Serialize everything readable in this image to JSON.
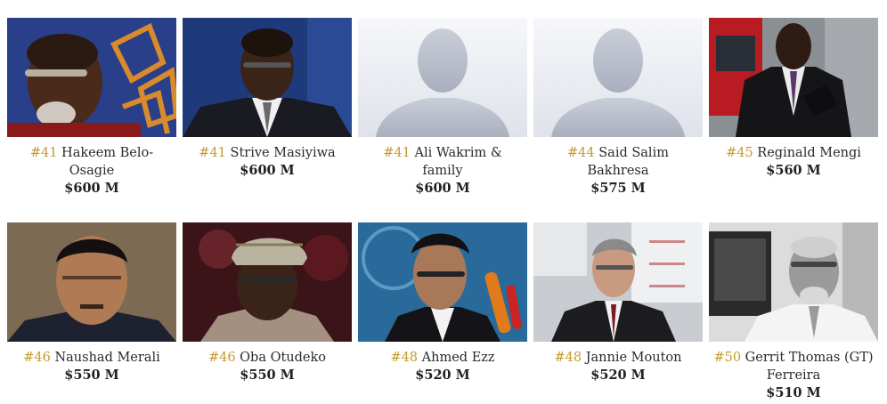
{
  "people": [
    {
      "rank": "#41",
      "name": "Hakeem Belo-Osagie",
      "worth": "$600 M",
      "photo": "portrait"
    },
    {
      "rank": "#41",
      "name": "Strive Masiyiwa",
      "worth": "$600 M",
      "photo": "portrait"
    },
    {
      "rank": "#41",
      "name": "Ali Wakrim & family",
      "worth": "$600 M",
      "photo": "placeholder"
    },
    {
      "rank": "#44",
      "name": "Said Salim Bakhresa",
      "worth": "$575 M",
      "photo": "placeholder"
    },
    {
      "rank": "#45",
      "name": "Reginald Mengi",
      "worth": "$560 M",
      "photo": "portrait"
    },
    {
      "rank": "#46",
      "name": "Naushad Merali",
      "worth": "$550 M",
      "photo": "portrait"
    },
    {
      "rank": "#46",
      "name": "Oba Otudeko",
      "worth": "$550 M",
      "photo": "portrait"
    },
    {
      "rank": "#48",
      "name": "Ahmed Ezz",
      "worth": "$520 M",
      "photo": "portrait"
    },
    {
      "rank": "#48",
      "name": "Jannie Mouton",
      "worth": "$520 M",
      "photo": "portrait"
    },
    {
      "rank": "#50",
      "name": "Gerrit Thomas (GT) Ferreira",
      "worth": "$510 M",
      "photo": "portrait"
    }
  ],
  "colors": {
    "rank": "#c49a2a"
  }
}
